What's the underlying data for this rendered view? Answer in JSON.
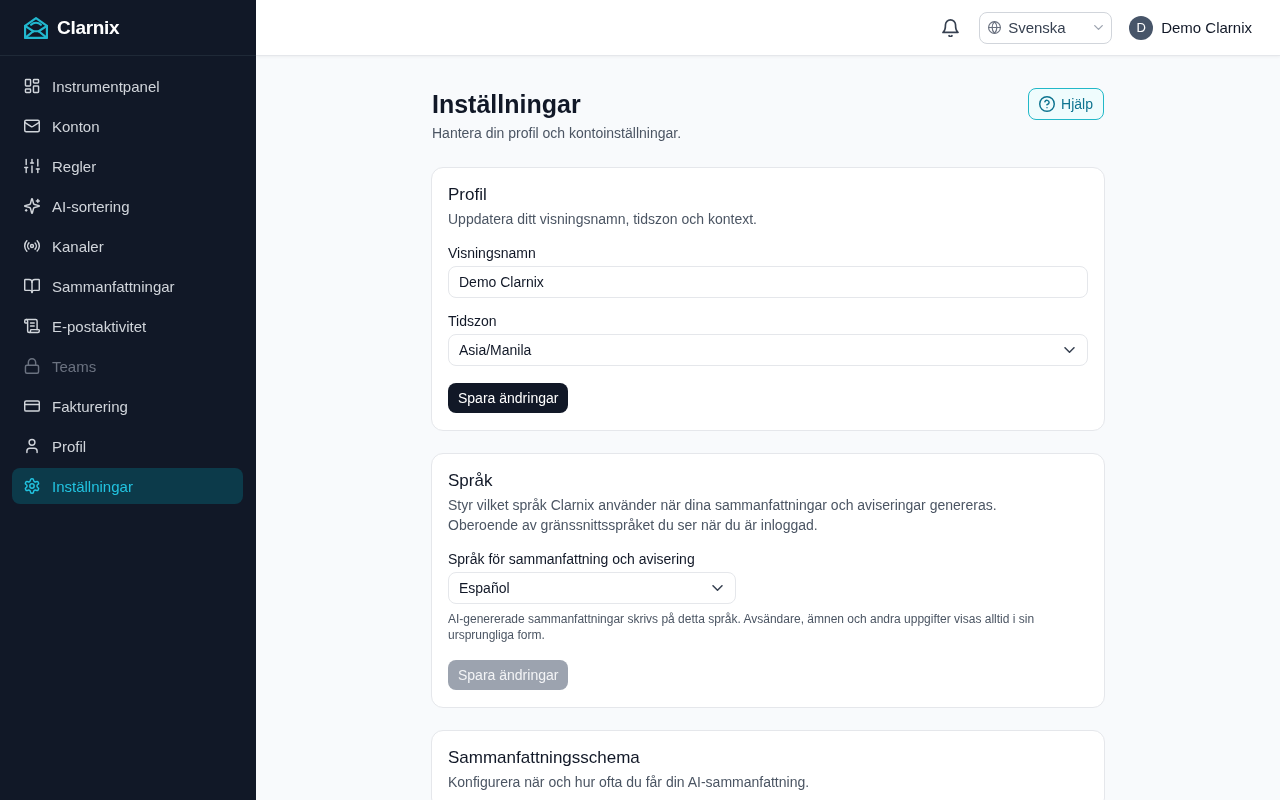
{
  "sidebar": {
    "brand": "Clarnix",
    "items": [
      {
        "label": "Instrumentpanel",
        "kind": "grid",
        "selected": false,
        "disabled": false
      },
      {
        "label": "Konton",
        "kind": "mail",
        "selected": false,
        "disabled": false
      },
      {
        "label": "Regler",
        "kind": "sliders",
        "selected": false,
        "disabled": false
      },
      {
        "label": "AI-sortering",
        "kind": "sparkles",
        "selected": false,
        "disabled": false
      },
      {
        "label": "Kanaler",
        "kind": "broadcast",
        "selected": false,
        "disabled": false
      },
      {
        "label": "Sammanfattningar",
        "kind": "book",
        "selected": false,
        "disabled": false
      },
      {
        "label": "E-postaktivitet",
        "kind": "scroll",
        "selected": false,
        "disabled": false
      },
      {
        "label": "Teams",
        "kind": "lock",
        "selected": false,
        "disabled": true
      },
      {
        "label": "Fakturering",
        "kind": "card",
        "selected": false,
        "disabled": false
      },
      {
        "label": "Profil",
        "kind": "user",
        "selected": false,
        "disabled": false
      },
      {
        "label": "Inställningar",
        "kind": "gear",
        "selected": true,
        "disabled": false
      }
    ]
  },
  "topbar": {
    "language": "Svenska",
    "user": {
      "initial": "D",
      "name": "Demo Clarnix"
    }
  },
  "header": {
    "title": "Inställningar",
    "subtitle": "Hantera din profil och kontoinställningar.",
    "help_button": "Hjälp"
  },
  "sections": [
    {
      "title": "Profil",
      "description": "Uppdatera ditt visningsnamn, tidszon och kontext.",
      "fields": [
        {
          "kind": "text",
          "label": "Visningsnamn",
          "value": "Demo Clarnix"
        },
        {
          "kind": "select",
          "label": "Tidszon",
          "value": "Asia/Manila"
        }
      ],
      "button": {
        "label": "Spara ändringar",
        "disabled": false
      }
    },
    {
      "title": "Språk",
      "description": "Styr vilket språk Clarnix använder när dina sammanfattningar och aviseringar genereras. Oberoende av gränssnittsspråket du ser när du är inloggad.",
      "fields": [
        {
          "kind": "select",
          "label": "Språk för sammanfattning och avisering",
          "value": "Español",
          "hint": "AI-genererade sammanfattningar skrivs på detta språk. Avsändare, ämnen och andra uppgifter visas alltid i sin ursprungliga form."
        }
      ],
      "button": {
        "label": "Spara ändringar",
        "disabled": true
      }
    },
    {
      "title": "Sammanfattningsschema",
      "description": "Konfigurera när och hur ofta du får din AI-sammanfattning."
    }
  ]
}
